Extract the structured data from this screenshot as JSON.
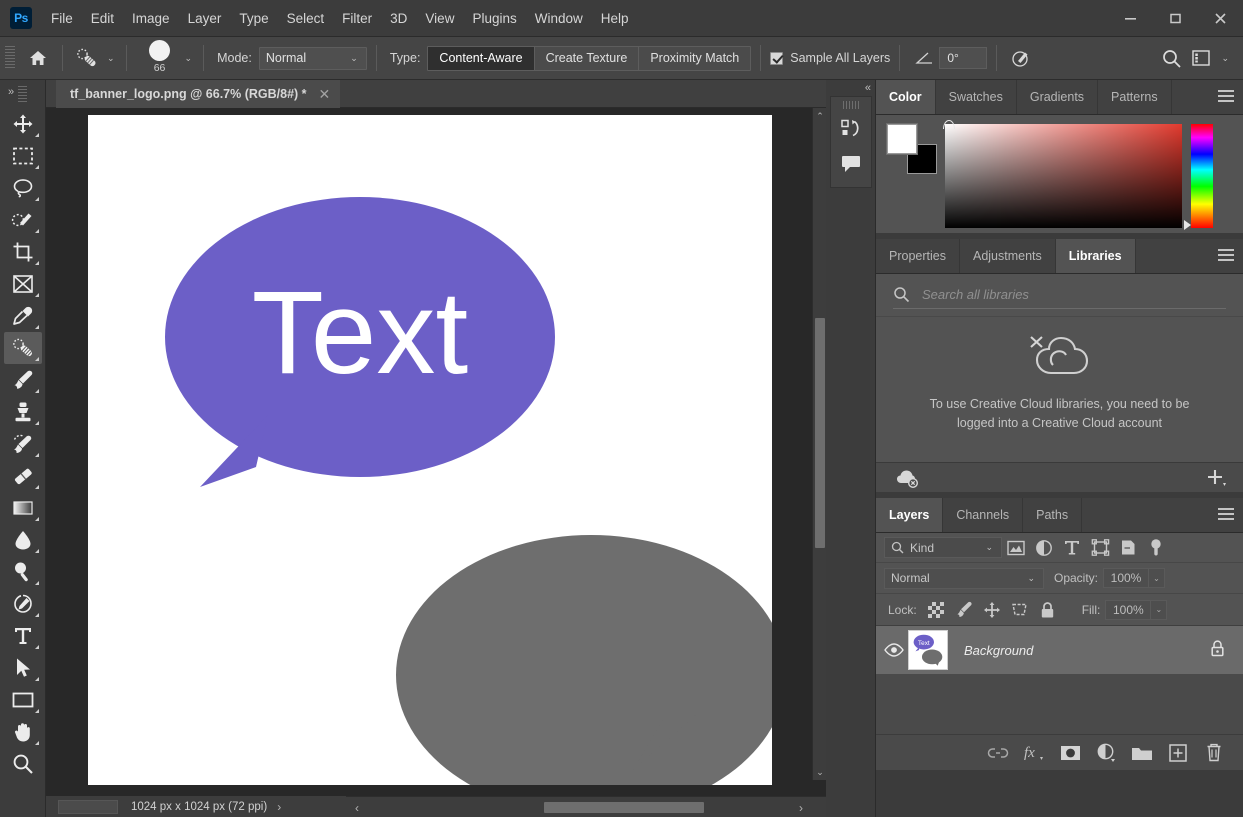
{
  "app": {
    "logo": "Ps",
    "menu": [
      "File",
      "Edit",
      "Image",
      "Layer",
      "Type",
      "Select",
      "Filter",
      "3D",
      "View",
      "Plugins",
      "Window",
      "Help"
    ],
    "window_controls": [
      "minimize",
      "maximize",
      "close"
    ]
  },
  "options_bar": {
    "home_icon": "home-icon",
    "tool_preset_icon": "spot-healing-brush-icon",
    "brush_size": "66",
    "mode_label": "Mode:",
    "mode_value": "Normal",
    "type_label": "Type:",
    "type_options": [
      "Content-Aware",
      "Create Texture",
      "Proximity Match"
    ],
    "type_selected": "Content-Aware",
    "sample_all_layers_label": "Sample All Layers",
    "sample_all_layers_checked": true,
    "angle_value": "0°",
    "pressure_icon": "pressure-size-icon",
    "search_icon": "search-icon",
    "workspace_icon": "workspace-switcher-icon"
  },
  "document": {
    "tab_title": "tf_banner_logo.png @ 66.7% (RGB/8#) *",
    "close_icon": "close-icon"
  },
  "toolbar": {
    "tools": [
      {
        "name": "move-tool",
        "icon": "move-icon",
        "selected": false
      },
      {
        "name": "rectangular-marquee-tool",
        "icon": "marquee-icon",
        "selected": false
      },
      {
        "name": "lasso-tool",
        "icon": "lasso-icon",
        "selected": false
      },
      {
        "name": "object-selection-tool",
        "icon": "quick-selection-icon",
        "selected": false
      },
      {
        "name": "crop-tool",
        "icon": "crop-icon",
        "selected": false
      },
      {
        "name": "frame-tool",
        "icon": "frame-icon",
        "selected": false
      },
      {
        "name": "eyedropper-tool",
        "icon": "eyedropper-icon",
        "selected": false
      },
      {
        "name": "spot-healing-brush-tool",
        "icon": "healing-brush-icon",
        "selected": true
      },
      {
        "name": "brush-tool",
        "icon": "brush-icon",
        "selected": false
      },
      {
        "name": "clone-stamp-tool",
        "icon": "stamp-icon",
        "selected": false
      },
      {
        "name": "history-brush-tool",
        "icon": "history-brush-icon",
        "selected": false
      },
      {
        "name": "eraser-tool",
        "icon": "eraser-icon",
        "selected": false
      },
      {
        "name": "gradient-tool",
        "icon": "gradient-icon",
        "selected": false
      },
      {
        "name": "blur-tool",
        "icon": "blur-drop-icon",
        "selected": false
      },
      {
        "name": "dodge-tool",
        "icon": "dodge-icon",
        "selected": false
      },
      {
        "name": "pen-tool",
        "icon": "pen-icon",
        "selected": false
      },
      {
        "name": "type-tool",
        "icon": "type-t-icon",
        "selected": false
      },
      {
        "name": "path-selection-tool",
        "icon": "path-arrow-icon",
        "selected": false
      },
      {
        "name": "rectangle-tool",
        "icon": "rectangle-icon",
        "selected": false
      },
      {
        "name": "hand-tool",
        "icon": "hand-icon",
        "selected": false
      },
      {
        "name": "zoom-tool",
        "icon": "zoom-magnifier-icon",
        "selected": false
      }
    ]
  },
  "artwork": {
    "bubble_text": "Text",
    "purple_color": "#6c5fc7",
    "gray_color": "#6e6e6e",
    "background_color": "#ffffff"
  },
  "status_bar": {
    "dimensions": "1024 px x 1024 px (72 ppi)",
    "next_icon": "chevron-right-icon",
    "prev_icon": "chevron-left-icon"
  },
  "rail": {
    "collapse_icon": "double-chevron-icon",
    "buttons": [
      {
        "name": "history-panel-button",
        "icon": "history-icon"
      },
      {
        "name": "comments-panel-button",
        "icon": "comment-bubble-icon"
      }
    ]
  },
  "color_panel": {
    "tabs": [
      "Color",
      "Swatches",
      "Gradients",
      "Patterns"
    ],
    "active_tab": "Color",
    "foreground": "#ffffff",
    "background": "#000000",
    "menu_icon": "panel-menu-icon"
  },
  "libraries_panel": {
    "tabs": [
      "Properties",
      "Adjustments",
      "Libraries"
    ],
    "active_tab": "Libraries",
    "search_placeholder": "Search all libraries",
    "search_icon": "search-icon",
    "cc_icon": "creative-cloud-offline-icon",
    "empty_message": "To use Creative Cloud libraries, you need to be logged into a Creative Cloud account",
    "footer_left_icon": "cloud-offline-icon",
    "footer_right_icon": "add-icon",
    "menu_icon": "panel-menu-icon"
  },
  "layers_panel": {
    "tabs": [
      "Layers",
      "Channels",
      "Paths"
    ],
    "active_tab": "Layers",
    "menu_icon": "panel-menu-icon",
    "filter_kind": "Kind",
    "filter_icons": [
      "pixel-filter-icon",
      "adjustment-filter-icon",
      "type-filter-icon",
      "shape-filter-icon",
      "smart-object-filter-icon",
      "filter-toggle-icon"
    ],
    "blend_mode": "Normal",
    "opacity_label": "Opacity:",
    "opacity_value": "100%",
    "lock_label": "Lock:",
    "lock_icons": [
      "lock-transparent-pixels-icon",
      "lock-image-pixels-icon",
      "lock-position-icon",
      "lock-artboard-icon",
      "lock-all-icon"
    ],
    "fill_label": "Fill:",
    "fill_value": "100%",
    "layers": [
      {
        "name": "Background",
        "visible": true,
        "locked": true,
        "thumb_text": "Text"
      }
    ],
    "footer_icons": [
      "link-layers-icon",
      "layer-style-fx-icon",
      "layer-mask-icon",
      "adjustment-layer-icon",
      "new-group-icon",
      "new-layer-icon",
      "delete-layer-icon"
    ]
  }
}
